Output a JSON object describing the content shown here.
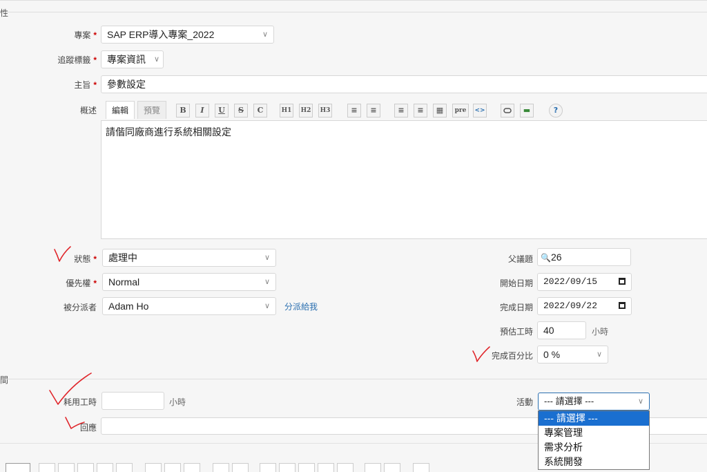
{
  "legend_top": "性",
  "legend_time": "間",
  "project": {
    "label": "專案",
    "value": "SAP ERP導入專案_2022"
  },
  "tracker": {
    "label": "追蹤標籤",
    "value": "專案資訊"
  },
  "subject": {
    "label": "主旨",
    "value": "參數設定"
  },
  "description": {
    "label": "概述",
    "tab_edit": "編輯",
    "tab_preview": "預覽",
    "toolbar": [
      "B",
      "I",
      "U",
      "S",
      "C",
      "H1",
      "H2",
      "H3",
      "≡",
      "≡",
      "≡",
      "≡",
      "▦",
      "pre",
      "<>",
      "",
      "▬",
      "?"
    ],
    "text": "請偕同廠商進行系統相關設定"
  },
  "status": {
    "label": "狀態",
    "value": "處理中"
  },
  "priority": {
    "label": "優先權",
    "value": "Normal"
  },
  "assignee": {
    "label": "被分派者",
    "value": "Adam Ho",
    "assign_me": "分派給我"
  },
  "parent": {
    "label": "父議題",
    "value": "26"
  },
  "start_date": {
    "label": "開始日期",
    "value": "2022/09/15"
  },
  "due_date": {
    "label": "完成日期",
    "value": "2022/09/22"
  },
  "estimated": {
    "label": "預估工時",
    "value": "40",
    "unit": "小時"
  },
  "done_ratio": {
    "label": "完成百分比",
    "value": "0 %"
  },
  "spent": {
    "label": "耗用工時",
    "value": "",
    "unit": "小時"
  },
  "activity": {
    "label": "活動",
    "value": "--- 請選擇 ---",
    "options": [
      "--- 請選擇 ---",
      "專案管理",
      "需求分析",
      "系統開發"
    ]
  },
  "comment": {
    "label": "回應"
  },
  "colors": {
    "required": "#cc0000",
    "link": "#2a6fb0",
    "selected": "#1a6fd0",
    "annotation": "#e0262b"
  }
}
